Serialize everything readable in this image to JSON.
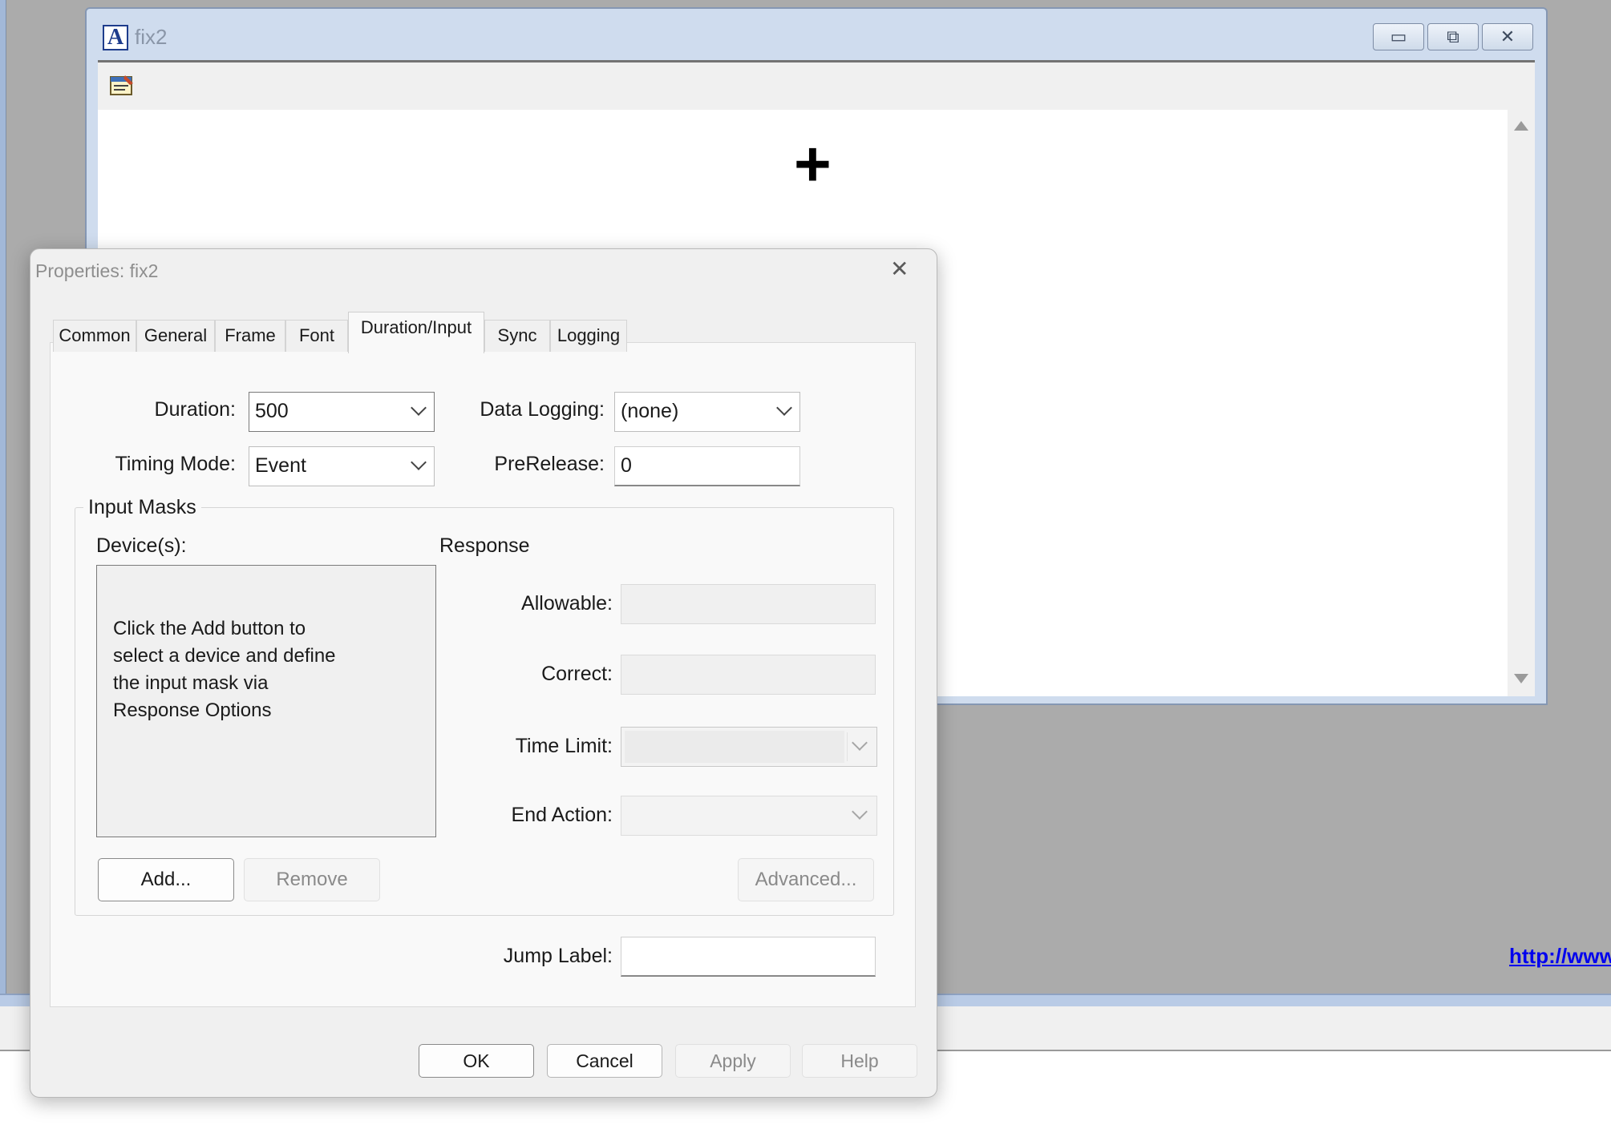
{
  "child_window": {
    "title": "fix2",
    "app_icon_letter": "A",
    "caption_buttons": {
      "minimize": "▭",
      "maximize": "⧉",
      "close": "✕"
    },
    "toolbar_icon": "properties-icon",
    "canvas_glyph": "+"
  },
  "background": {
    "url_text": "http://www"
  },
  "dialog": {
    "title": "Properties: fix2",
    "close_glyph": "✕",
    "tabs": [
      {
        "label": "Common"
      },
      {
        "label": "General"
      },
      {
        "label": "Frame"
      },
      {
        "label": "Font"
      },
      {
        "label": "Duration/Input",
        "active": true
      },
      {
        "label": "Sync"
      },
      {
        "label": "Logging"
      }
    ],
    "duration": {
      "label": "Duration:",
      "value": "500"
    },
    "data_logging": {
      "label": "Data Logging:",
      "value": "(none)"
    },
    "timing_mode": {
      "label": "Timing Mode:",
      "value": "Event"
    },
    "prerelease": {
      "label": "PreRelease:",
      "value": "0"
    },
    "input_masks": {
      "legend": "Input Masks",
      "devices_label": "Device(s):",
      "devices_hint": "Click the Add button to\nselect a device and define\nthe input mask via\nResponse Options",
      "response_label": "Response",
      "allowable_label": "Allowable:",
      "correct_label": "Correct:",
      "time_limit_label": "Time Limit:",
      "end_action_label": "End Action:",
      "add_button": "Add...",
      "remove_button": "Remove",
      "advanced_button": "Advanced..."
    },
    "jump_label": {
      "label": "Jump Label:",
      "value": ""
    },
    "footer": {
      "ok": "OK",
      "cancel": "Cancel",
      "apply": "Apply",
      "help": "Help"
    }
  },
  "colors": {
    "mdi_background": "#ababab",
    "window_frame": "#cfdcee",
    "dialog_background": "#f0f0f0",
    "link": "#0000ee"
  }
}
